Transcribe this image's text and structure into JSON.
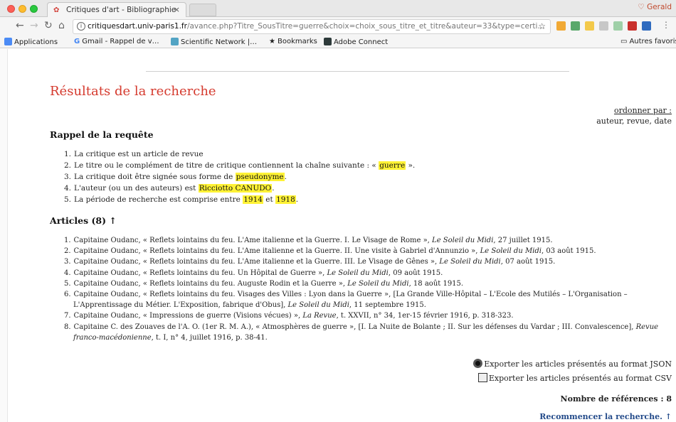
{
  "browser": {
    "tab_title": "Critiques d'art - Bibliographie",
    "tab_close": "×",
    "user_name": "Gerald",
    "address_host": "critiquesdart.univ-paris1.fr",
    "address_path": "/avance.php?Titre_SousTitre=guerre&choix=choix_sous_titre_et_titre&auteur=33&type=certi…",
    "bookmarks": [
      "Applications",
      "Gmail - Rappel de v…",
      "Scientific Network |…",
      "Bookmarks",
      "Adobe Connect"
    ],
    "other_bookmarks": "Autres favoris"
  },
  "page": {
    "title": "Résultats de la recherche",
    "order_label": "ordonner par :",
    "order_options": "auteur, revue, date",
    "request_heading": "Rappel de la requête",
    "request_items": [
      {
        "num": "1.",
        "pre": "La critique est un article de revue",
        "mark": "",
        "post": ""
      },
      {
        "num": "2.",
        "pre": "Le titre ou le complément de titre de critique contiennent la chaîne suivante : « ",
        "mark": "guerre",
        "post": " »."
      },
      {
        "num": "3.",
        "pre": "La critique doit être signée sous forme de ",
        "mark": "pseudonyme",
        "post": "."
      },
      {
        "num": "4.",
        "pre": "L'auteur (ou un des auteurs) est ",
        "mark": "Ricciotto CANUDO",
        "post": "."
      }
    ],
    "period": {
      "num": "5.",
      "pre": "La période de recherche est comprise entre ",
      "from": "1914",
      "mid": " et ",
      "to": "1918",
      "post": "."
    },
    "articles_heading": "Articles (8) ↑",
    "articles": [
      {
        "num": "1.",
        "text": "Capitaine Oudanc, « Reflets lointains du feu. L'Ame italienne et la Guerre. I. Le Visage de Rome », ",
        "source": "Le Soleil du Midi",
        "after": ", 27 juillet 1915."
      },
      {
        "num": "2.",
        "text": "Capitaine Oudanc, « Reflets lointains du feu. L'Ame italienne et la Guerre. II. Une visite à Gabriel d'Annunzio », ",
        "source": "Le Soleil du Midi",
        "after": ", 03 août 1915."
      },
      {
        "num": "3.",
        "text": "Capitaine Oudanc, « Reflets lointains du feu. L'Ame italienne et la Guerre. III. Le Visage de Gênes », ",
        "source": "Le Soleil du Midi",
        "after": ", 07 août 1915."
      },
      {
        "num": "4.",
        "text": "Capitaine Oudanc, « Reflets lointains du feu. Un Hôpital de Guerre », ",
        "source": "Le Soleil du Midi",
        "after": ", 09 août 1915."
      },
      {
        "num": "5.",
        "text": "Capitaine Oudanc, « Reflets lointains du feu. Auguste Rodin et la Guerre », ",
        "source": "Le Soleil du Midi",
        "after": ", 18 août 1915."
      },
      {
        "num": "6.",
        "text": "Capitaine Oudanc, « Reflets lointains du feu. Visages des Villes : Lyon dans la Guerre », [La Grande Ville-Hôpital – L'Ecole des Mutilés – L'Organisation – L'Apprentissage du Métier. L'Exposition, fabrique d'Obus], ",
        "source": "Le Soleil du Midi",
        "after": ", 11 septembre 1915."
      },
      {
        "num": "7.",
        "text": "Capitaine Oudanc, « Impressions de guerre (Visions vécues) », ",
        "source": "La Revue",
        "after": ", t. XXVII, n° 34, 1er-15 février 1916, p. 318-323."
      },
      {
        "num": "8.",
        "text": "Capitaine C. des Zouaves de l'A. O. (1er R. M. A.), « Atmosphères de guerre », [I. La Nuite de Bolante ; II. Sur les défenses du Vardar ; III. Convalescence], ",
        "source": "Revue franco-macédonienne",
        "after": ", t. I, n° 4, juillet 1916, p. 38-41."
      }
    ],
    "export_json": "Exporter les articles présentés au format JSON",
    "export_csv": "Exporter les articles présentés au format CSV",
    "nb_references": "Nombre de références : 8",
    "restart": "Recommencer la recherche. ↑"
  }
}
